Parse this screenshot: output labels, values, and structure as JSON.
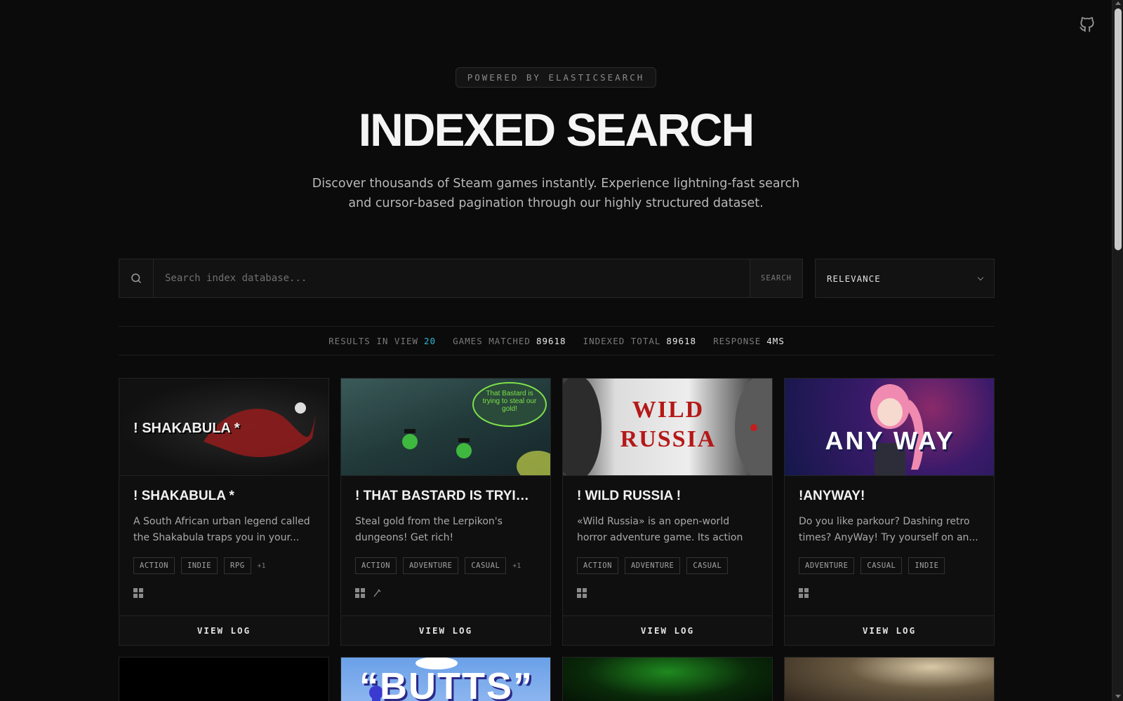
{
  "header": {
    "github_icon": "github-icon"
  },
  "hero": {
    "badge": "POWERED BY ELASTICSEARCH",
    "title": "INDEXED SEARCH",
    "subtitle": "Discover thousands of Steam games instantly. Experience lightning-fast search and cursor-based pagination through our highly structured dataset."
  },
  "search": {
    "placeholder": "Search index database...",
    "button_label": "SEARCH",
    "sort_value": "RELEVANCE"
  },
  "stats": {
    "results_label": "RESULTS IN VIEW",
    "results_value": "20",
    "matched_label": "GAMES MATCHED",
    "matched_value": "89618",
    "indexed_label": "INDEXED TOTAL",
    "indexed_value": "89618",
    "response_label": "RESPONSE",
    "response_value": "4MS"
  },
  "cards": [
    {
      "title": "! SHAKABULA *",
      "description": "A South African urban legend called the Shakabula traps you in your...",
      "tags": [
        "ACTION",
        "INDIE",
        "RPG"
      ],
      "more": "+1",
      "image_text": "! SHAKABULA *",
      "platforms": [
        "windows-icon"
      ],
      "action": "VIEW LOG"
    },
    {
      "title": "! THAT BASTARD IS TRYING...",
      "description": "Steal gold from the Lerpikon's dungeons! Get rich!",
      "tags": [
        "ACTION",
        "ADVENTURE",
        "CASUAL"
      ],
      "more": "+1",
      "image_text": "That Bastard is trying to steal our gold!",
      "platforms": [
        "windows-icon",
        "steam-icon"
      ],
      "action": "VIEW LOG"
    },
    {
      "title": "! WILD RUSSIA !",
      "description": "«Wild Russia» is an open-world horror adventure game. Its action takes...",
      "tags": [
        "ACTION",
        "ADVENTURE",
        "CASUAL"
      ],
      "more": "",
      "image_text_1": "WILD",
      "image_text_2": "RUSSIA",
      "platforms": [
        "windows-icon"
      ],
      "action": "VIEW LOG"
    },
    {
      "title": "!ANYWAY!",
      "description": "Do you like parkour? Dashing retro times? AnyWay! Try yourself on an...",
      "tags": [
        "ADVENTURE",
        "CASUAL",
        "INDIE"
      ],
      "more": "",
      "image_text": "ANY WAY",
      "platforms": [
        "windows-icon"
      ],
      "action": "VIEW LOG"
    }
  ],
  "next_row": [
    {
      "image_text": ""
    },
    {
      "image_text": "“BUTTS”"
    },
    {
      "image_text": ""
    },
    {
      "image_text": ""
    }
  ]
}
